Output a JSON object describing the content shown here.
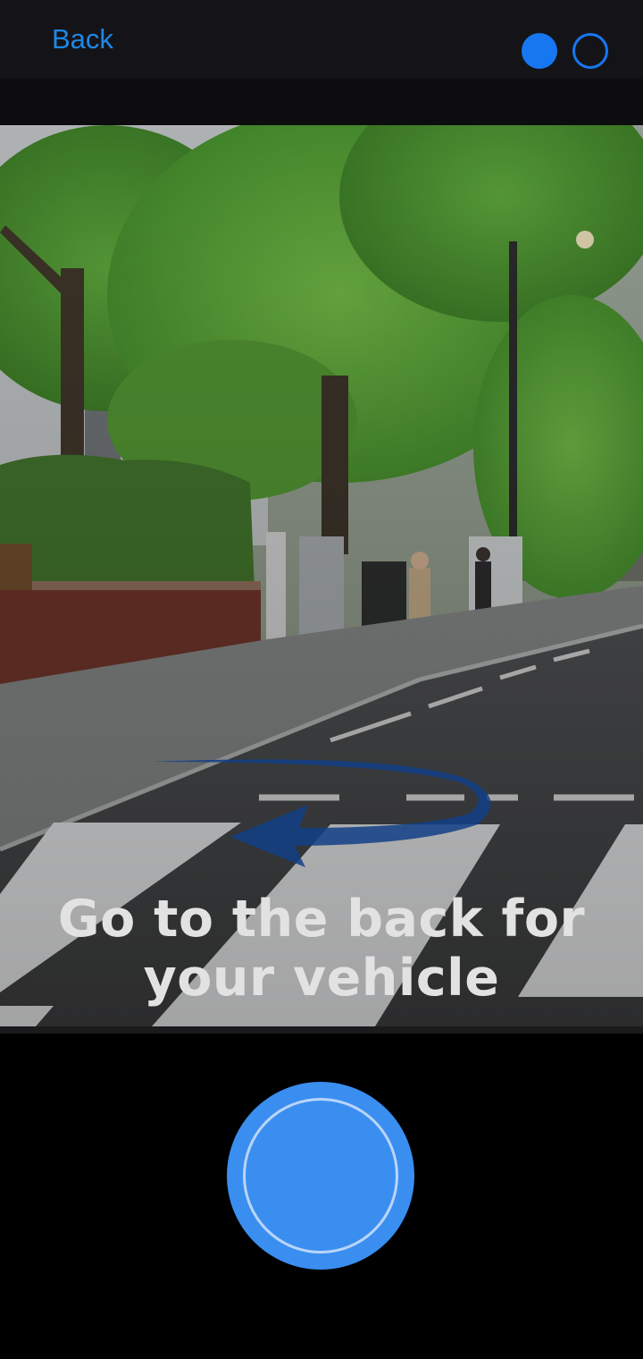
{
  "header": {
    "back_label": "Back",
    "steps": {
      "total": 2,
      "current": 1
    },
    "accent_color": "#1677f0"
  },
  "camera": {
    "instruction_line1": "Go to the back for",
    "instruction_line2": "your vehicle",
    "guide_icon": "u-turn-arrow-icon",
    "scene": "street-with-crosswalk-and-trees"
  },
  "capture": {
    "button_icon": "shutter-icon",
    "button_color": "#3a8ef0"
  }
}
